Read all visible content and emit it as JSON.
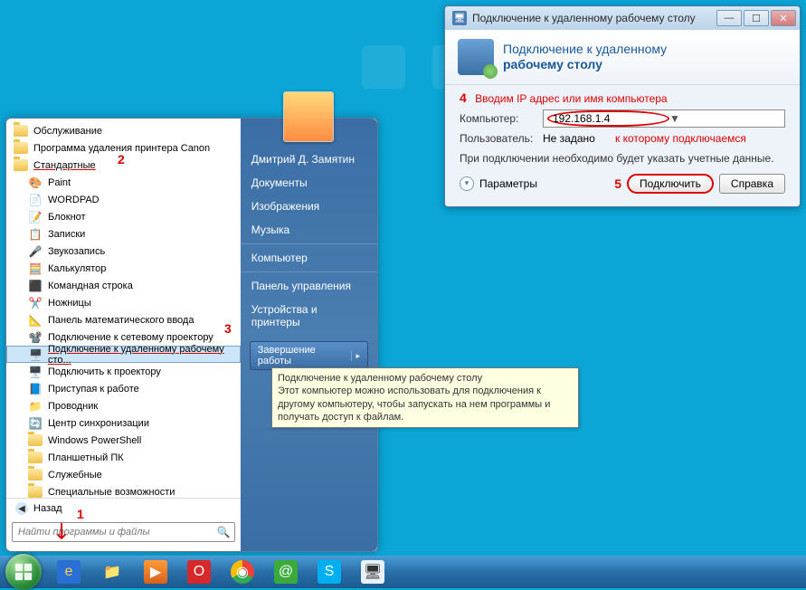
{
  "start_menu": {
    "user_name": "Дмитрий Д. Замятин",
    "left": [
      {
        "label": "Обслуживание",
        "type": "folder"
      },
      {
        "label": "Программа удаления принтера Canon",
        "type": "folder"
      },
      {
        "label": "Стандартные",
        "type": "folder",
        "underline": true
      },
      {
        "label": "Paint",
        "type": "app",
        "icon": "🎨",
        "indent": true
      },
      {
        "label": "WORDPAD",
        "type": "app",
        "icon": "📄",
        "indent": true
      },
      {
        "label": "Блокнот",
        "type": "app",
        "icon": "📝",
        "indent": true
      },
      {
        "label": "Записки",
        "type": "app",
        "icon": "📋",
        "indent": true
      },
      {
        "label": "Звукозапись",
        "type": "app",
        "icon": "🎤",
        "indent": true
      },
      {
        "label": "Калькулятор",
        "type": "app",
        "icon": "🧮",
        "indent": true
      },
      {
        "label": "Командная строка",
        "type": "app",
        "icon": "⬛",
        "indent": true
      },
      {
        "label": "Ножницы",
        "type": "app",
        "icon": "✂️",
        "indent": true
      },
      {
        "label": "Панель математического ввода",
        "type": "app",
        "icon": "📐",
        "indent": true
      },
      {
        "label": "Подключение к сетевому проектору",
        "type": "app",
        "icon": "📽️",
        "indent": true
      },
      {
        "label": "Подключение к удаленному рабочему сто...",
        "type": "app",
        "icon": "🖥️",
        "indent": true,
        "selected": true,
        "underline": true
      },
      {
        "label": "Подключить к проектору",
        "type": "app",
        "icon": "🖥️",
        "indent": true
      },
      {
        "label": "Приступая к работе",
        "type": "app",
        "icon": "📘",
        "indent": true
      },
      {
        "label": "Проводник",
        "type": "app",
        "icon": "📁",
        "indent": true
      },
      {
        "label": "Центр синхронизации",
        "type": "app",
        "icon": "🔄",
        "indent": true
      },
      {
        "label": "Windows PowerShell",
        "type": "folder",
        "indent": true
      },
      {
        "label": "Планшетный ПК",
        "type": "folder",
        "indent": true
      },
      {
        "label": "Служебные",
        "type": "folder",
        "indent": true
      },
      {
        "label": "Специальные возможности",
        "type": "folder",
        "indent": true
      }
    ],
    "back_label": "Назад",
    "search_placeholder": "Найти программы и файлы",
    "right": [
      {
        "label": "Документы"
      },
      {
        "label": "Изображения"
      },
      {
        "label": "Музыка"
      },
      {
        "sep": true
      },
      {
        "label": "Компьютер"
      },
      {
        "sep": true
      },
      {
        "label": "Панель управления"
      },
      {
        "label": "Устройства и принтеры"
      }
    ],
    "shutdown_label": "Завершение работы"
  },
  "tooltip": {
    "title": "Подключение к удаленному рабочему столу",
    "body": "Этот компьютер можно использовать для подключения к другому компьютеру, чтобы запускать на нем программы и получать доступ к файлам."
  },
  "annotations": {
    "n1": "1",
    "n2": "2",
    "n3": "3",
    "n4": "4",
    "n5": "5",
    "note_enter": "Вводим IP адрес или имя компьютера",
    "note_target": "к которому подключаемся"
  },
  "rdp": {
    "window_title": "Подключение к удаленному рабочему столу",
    "header_line1": "Подключение к удаленному",
    "header_line2": "рабочему столу",
    "computer_label": "Компьютер:",
    "computer_value": "192.168.1.4",
    "user_label": "Пользователь:",
    "user_value": "Не задано",
    "info": "При подключении необходимо будет указать учетные данные.",
    "params_label": "Параметры",
    "connect_label": "Подключить",
    "help_label": "Справка"
  },
  "taskbar": {
    "items": [
      {
        "name": "ie-icon",
        "glyph": "e",
        "bg": "#2a6fd6",
        "color": "#ffd24a"
      },
      {
        "name": "explorer-icon",
        "glyph": "📁",
        "bg": "transparent"
      },
      {
        "name": "wmp-icon",
        "glyph": "▶",
        "bg": "linear-gradient(#ff9a3a,#d9601a)",
        "color": "#fff"
      },
      {
        "name": "opera-icon",
        "glyph": "O",
        "bg": "#d62a2a",
        "color": "#fff"
      },
      {
        "name": "chrome-icon",
        "glyph": "◉",
        "bg": "conic-gradient(#ea4335 0 120deg,#34a853 120deg 240deg,#fbbc05 240deg 360deg)",
        "color": "#fff"
      },
      {
        "name": "mail-icon",
        "glyph": "@",
        "bg": "#3aaa3a",
        "color": "#fff"
      },
      {
        "name": "skype-icon",
        "glyph": "S",
        "bg": "#00aff0",
        "color": "#fff"
      },
      {
        "name": "rdp-task-icon",
        "glyph": "🖥",
        "bg": "#e8f0f8"
      }
    ]
  }
}
